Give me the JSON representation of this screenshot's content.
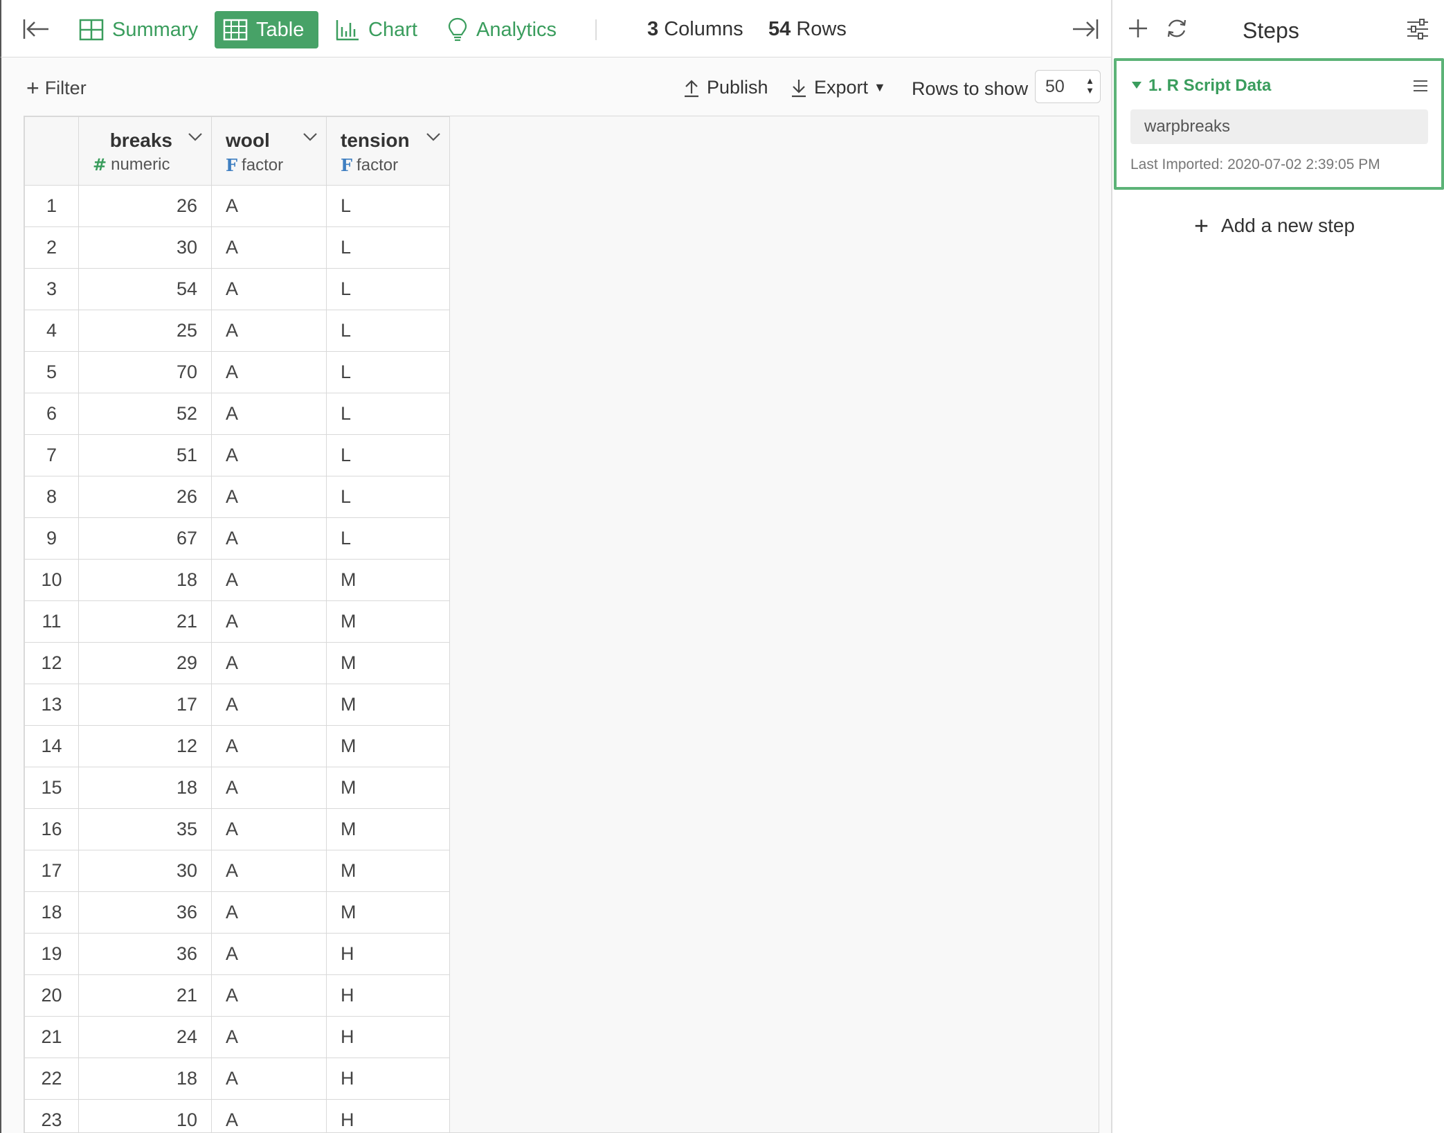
{
  "toolbar": {
    "tabs": [
      {
        "label": "Summary"
      },
      {
        "label": "Table"
      },
      {
        "label": "Chart"
      },
      {
        "label": "Analytics"
      }
    ],
    "columns_count": "3",
    "columns_label": "Columns",
    "rows_count": "54",
    "rows_label": "Rows",
    "accent_color": "#47a267"
  },
  "actions": {
    "filter_label": "Filter",
    "publish_label": "Publish",
    "export_label": "Export",
    "rows_to_show_label": "Rows to show",
    "rows_to_show_value": "50"
  },
  "table": {
    "columns": [
      {
        "name": "breaks",
        "type": "numeric",
        "type_icon": "#"
      },
      {
        "name": "wool",
        "type": "factor",
        "type_icon": "F"
      },
      {
        "name": "tension",
        "type": "factor",
        "type_icon": "F"
      }
    ],
    "rows": [
      [
        "1",
        "26",
        "A",
        "L"
      ],
      [
        "2",
        "30",
        "A",
        "L"
      ],
      [
        "3",
        "54",
        "A",
        "L"
      ],
      [
        "4",
        "25",
        "A",
        "L"
      ],
      [
        "5",
        "70",
        "A",
        "L"
      ],
      [
        "6",
        "52",
        "A",
        "L"
      ],
      [
        "7",
        "51",
        "A",
        "L"
      ],
      [
        "8",
        "26",
        "A",
        "L"
      ],
      [
        "9",
        "67",
        "A",
        "L"
      ],
      [
        "10",
        "18",
        "A",
        "M"
      ],
      [
        "11",
        "21",
        "A",
        "M"
      ],
      [
        "12",
        "29",
        "A",
        "M"
      ],
      [
        "13",
        "17",
        "A",
        "M"
      ],
      [
        "14",
        "12",
        "A",
        "M"
      ],
      [
        "15",
        "18",
        "A",
        "M"
      ],
      [
        "16",
        "35",
        "A",
        "M"
      ],
      [
        "17",
        "30",
        "A",
        "M"
      ],
      [
        "18",
        "36",
        "A",
        "M"
      ],
      [
        "19",
        "36",
        "A",
        "H"
      ],
      [
        "20",
        "21",
        "A",
        "H"
      ],
      [
        "21",
        "24",
        "A",
        "H"
      ],
      [
        "22",
        "18",
        "A",
        "H"
      ],
      [
        "23",
        "10",
        "A",
        "H"
      ]
    ]
  },
  "steps": {
    "title": "Steps",
    "items": [
      {
        "title": "1. R Script Data",
        "source": "warpbreaks",
        "meta": "Last Imported: 2020-07-02 2:39:05 PM"
      }
    ],
    "add_label": "Add a new step"
  }
}
